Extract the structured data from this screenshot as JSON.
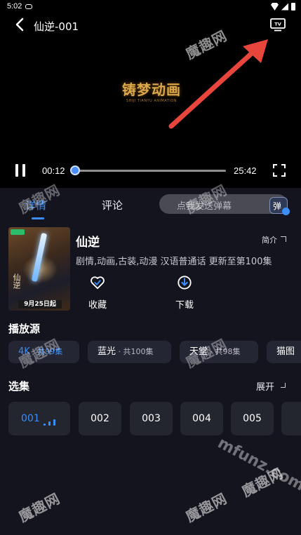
{
  "status_bar": {
    "time": "5:02"
  },
  "player": {
    "title": "仙逆-001",
    "brand_main": "铸梦动画",
    "brand_sub": "SHIJI TIANYU ANIMATION",
    "current_time": "00:12",
    "total_time": "25:42",
    "progress": 0.008
  },
  "tabs": {
    "detail": "详情",
    "comment": "评论",
    "danmaku_placeholder": "点我发送弹幕",
    "danmaku_icon_char": "弹"
  },
  "info": {
    "poster_title": "仙逆",
    "poster_date": "9月25日起",
    "name": "仙逆",
    "intro_label": "简介",
    "meta": "剧情,动画,古装,动漫 汉语普通话 更新至第100集",
    "favorite_label": "收藏",
    "download_label": "下载"
  },
  "sources": {
    "title": "播放源",
    "items": [
      {
        "name": "4K",
        "sub": " · 共99集",
        "active": true
      },
      {
        "name": "蓝光",
        "sub": " · 共100集",
        "active": false
      },
      {
        "name": "天堂",
        "sub": " · 共98集",
        "active": false
      },
      {
        "name": "猫图",
        "sub": "",
        "active": false
      }
    ]
  },
  "episodes": {
    "title": "选集",
    "expand_label": "展开",
    "items": [
      "001",
      "002",
      "003",
      "004",
      "005"
    ]
  },
  "watermark": {
    "text": "魔趣网",
    "url": "mfunz.com"
  },
  "colors": {
    "accent": "#3a8ef6",
    "background": "#14141f",
    "annotation_arrow": "#e8453c"
  }
}
